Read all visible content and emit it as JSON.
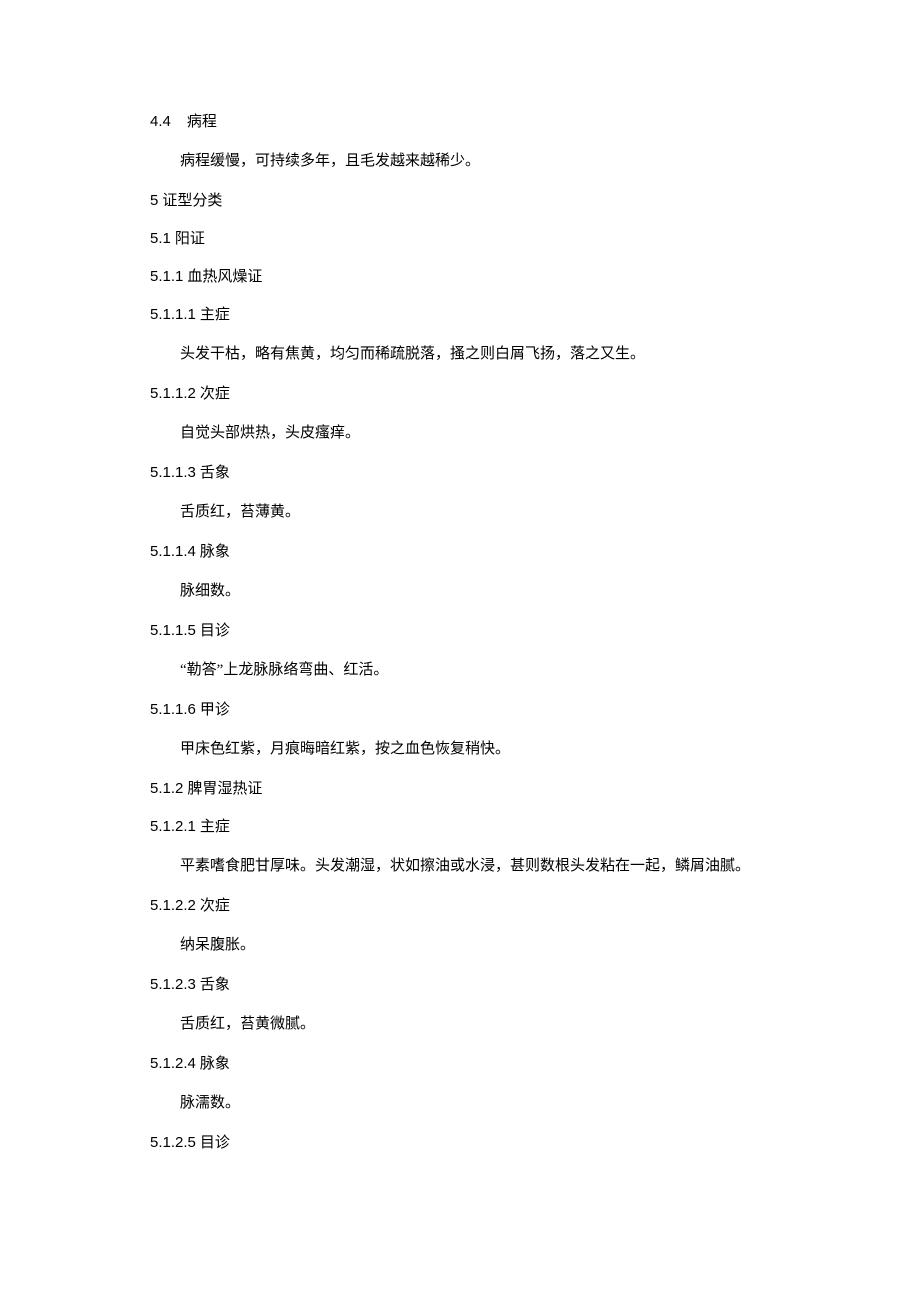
{
  "sections": [
    {
      "type": "h",
      "num": "4.4",
      "numClass": "num",
      "label": "病程"
    },
    {
      "type": "p",
      "text": "病程缓慢，可持续多年，且毛发越来越稀少。"
    },
    {
      "type": "h",
      "num": "5",
      "numClass": "num-tight",
      "label": "证型分类"
    },
    {
      "type": "h",
      "num": "5.1",
      "numClass": "num-tight",
      "label": "阳证"
    },
    {
      "type": "h",
      "num": "5.1.1",
      "numClass": "num-tight",
      "label": "血热风燥证"
    },
    {
      "type": "h",
      "num": "5.1.1.1",
      "numClass": "num-tight",
      "label": "主症"
    },
    {
      "type": "p",
      "text": "头发干枯，略有焦黄，均匀而稀疏脱落，搔之则白屑飞扬，落之又生。"
    },
    {
      "type": "h",
      "num": "5.1.1.2",
      "numClass": "num-tight",
      "label": "次症"
    },
    {
      "type": "p",
      "text": "自觉头部烘热，头皮瘙痒。"
    },
    {
      "type": "h",
      "num": "5.1.1.3",
      "numClass": "num-tight",
      "label": "舌象"
    },
    {
      "type": "p",
      "text": "舌质红，苔薄黄。"
    },
    {
      "type": "h",
      "num": "5.1.1.4",
      "numClass": "num-tight",
      "label": "脉象"
    },
    {
      "type": "p",
      "text": "脉细数。"
    },
    {
      "type": "h",
      "num": "5.1.1.5",
      "numClass": "num-tight",
      "label": "目诊"
    },
    {
      "type": "p",
      "text": "“勒答”上龙脉脉络弯曲、红活。"
    },
    {
      "type": "h",
      "num": "5.1.1.6",
      "numClass": "num-tight",
      "label": "甲诊"
    },
    {
      "type": "p",
      "text": "甲床色红紫，月痕晦暗红紫，按之血色恢复稍快。"
    },
    {
      "type": "h",
      "num": "5.1.2",
      "numClass": "num-tight",
      "label": "脾胃湿热证"
    },
    {
      "type": "h",
      "num": "5.1.2.1",
      "numClass": "num-tight",
      "label": "主症"
    },
    {
      "type": "p",
      "text": "平素嗜食肥甘厚味。头发潮湿，状如擦油或水浸，甚则数根头发粘在一起，鳞屑油腻。"
    },
    {
      "type": "h",
      "num": "5.1.2.2",
      "numClass": "num-tight",
      "label": "次症"
    },
    {
      "type": "p",
      "text": "纳呆腹胀。"
    },
    {
      "type": "h",
      "num": "5.1.2.3",
      "numClass": "num-tight",
      "label": "舌象"
    },
    {
      "type": "p",
      "text": "舌质红，苔黄微腻。"
    },
    {
      "type": "h",
      "num": "5.1.2.4",
      "numClass": "num-tight",
      "label": "脉象"
    },
    {
      "type": "p",
      "text": "脉濡数。"
    },
    {
      "type": "h",
      "num": "5.1.2.5",
      "numClass": "num-tight",
      "label": "目诊"
    }
  ]
}
